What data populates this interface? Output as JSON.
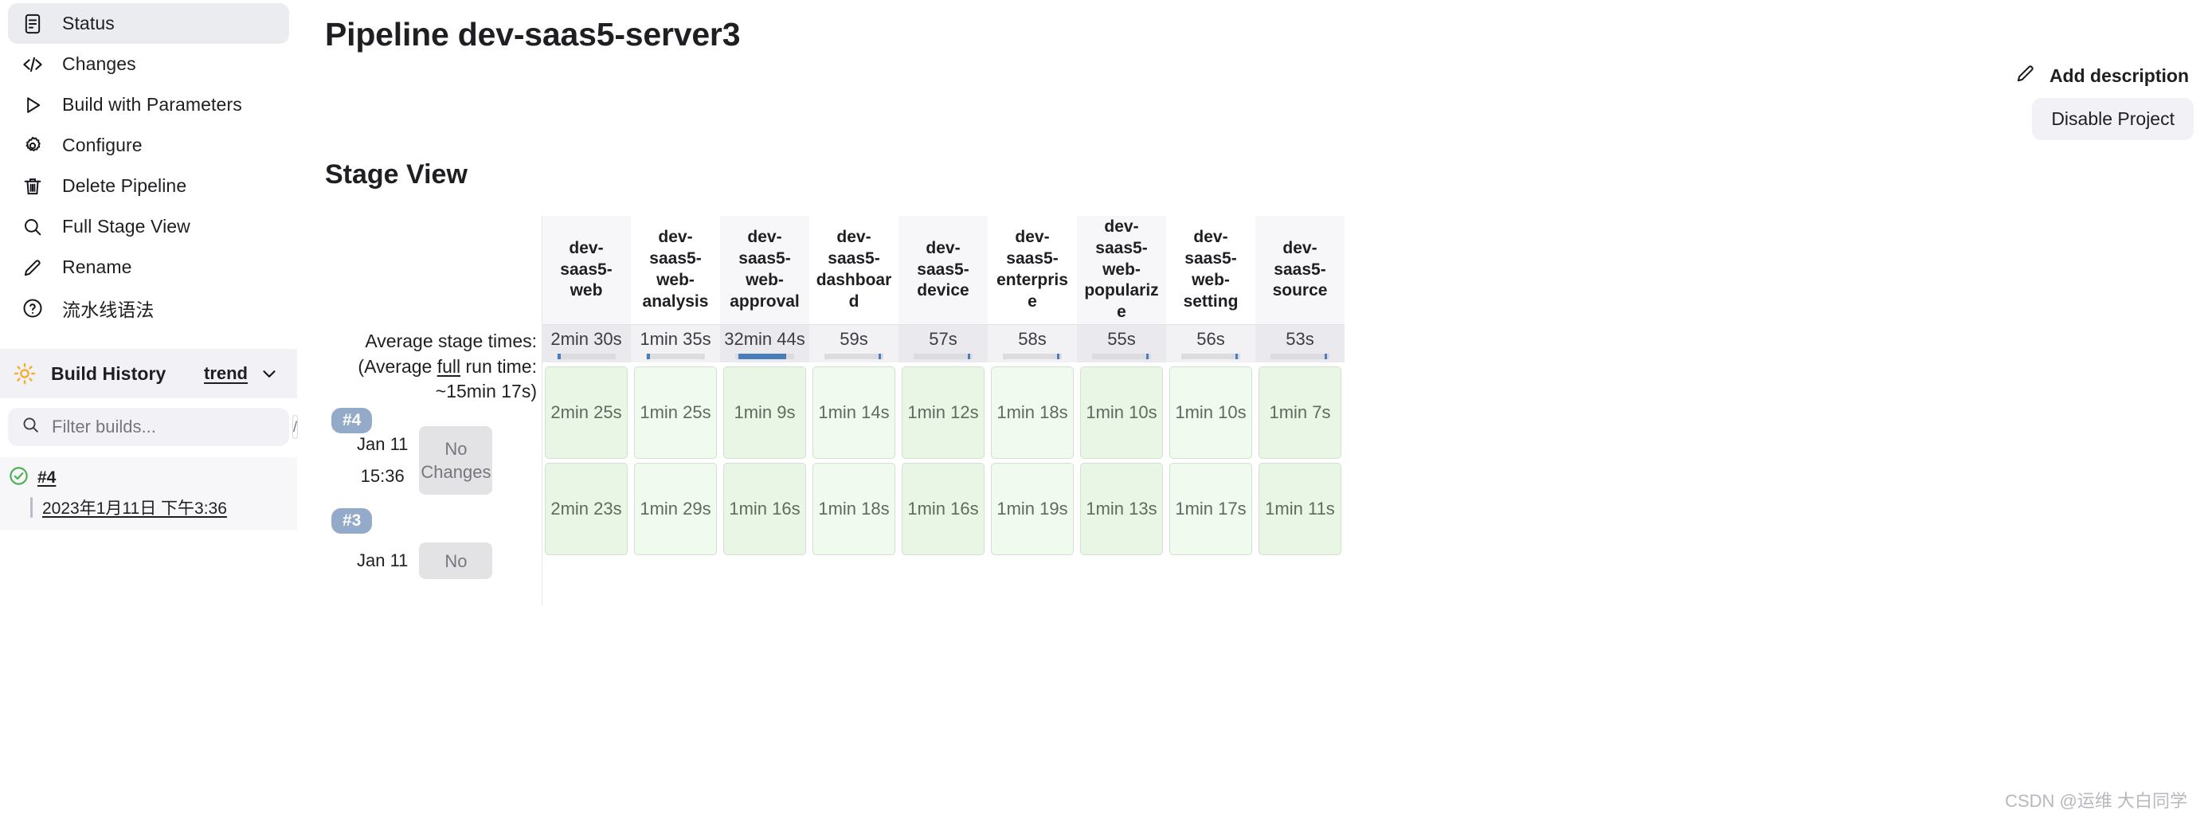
{
  "sidebar": {
    "items": [
      {
        "label": "Status",
        "icon": "document-icon",
        "active": true
      },
      {
        "label": "Changes",
        "icon": "code-icon",
        "active": false
      },
      {
        "label": "Build with Parameters",
        "icon": "play-icon",
        "active": false
      },
      {
        "label": "Configure",
        "icon": "gear-icon",
        "active": false
      },
      {
        "label": "Delete Pipeline",
        "icon": "trash-icon",
        "active": false
      },
      {
        "label": "Full Stage View",
        "icon": "search-icon",
        "active": false
      },
      {
        "label": "Rename",
        "icon": "pencil-icon",
        "active": false
      },
      {
        "label": "流水线语法",
        "icon": "question-icon",
        "active": false
      }
    ],
    "build_history": {
      "title": "Build History",
      "icon": "sun-icon",
      "trend_label": "trend",
      "filter_placeholder": "Filter builds...",
      "filter_value": "",
      "shortcut_key": "/",
      "builds": [
        {
          "number": "#4",
          "date": "2023年1月11日 下午3:36",
          "status": "success"
        }
      ]
    }
  },
  "header": {
    "title": "Pipeline dev-saas5-server3",
    "add_description_label": "Add description",
    "disable_project_label": "Disable Project"
  },
  "stage_view": {
    "title": "Stage View",
    "average_label_line1": "Average stage times:",
    "average_label_line2_pre": "(Average ",
    "average_label_line2_underline": "full",
    "average_label_line2_post": " run time: ~15min 17s)"
  },
  "chart_data": {
    "type": "table",
    "title": "Stage View",
    "categories": [
      "dev-saas5-web",
      "dev-saas5-web-analysis",
      "dev-saas5-web-approval",
      "dev-saas5-dashboard",
      "dev-saas5-device",
      "dev-saas5-enterprise",
      "dev-saas5-web-popularize",
      "dev-saas5-web-setting",
      "dev-saas5-source"
    ],
    "average_times": [
      "2min 30s",
      "1min 35s",
      "32min 44s",
      "59s",
      "57s",
      "58s",
      "55s",
      "56s",
      "53s"
    ],
    "average_seconds": [
      150,
      95,
      1964,
      59,
      57,
      58,
      55,
      56,
      53
    ],
    "progress_percent": [
      8,
      6,
      92,
      4,
      4,
      4,
      4,
      4,
      4
    ],
    "progress_marker_right": [
      false,
      false,
      false,
      true,
      true,
      true,
      true,
      true,
      true
    ],
    "series": [
      {
        "name": "#4",
        "badge": "#4",
        "date": "Jan 11",
        "time": "15:36",
        "changes": "No Changes",
        "values": [
          "2min 25s",
          "1min 25s",
          "1min 9s",
          "1min 14s",
          "1min 12s",
          "1min 18s",
          "1min 10s",
          "1min 10s",
          "1min 7s"
        ],
        "status": "success"
      },
      {
        "name": "#3",
        "badge": "#3",
        "date": "Jan 11",
        "time": "",
        "changes": "No",
        "values": [
          "2min 23s",
          "1min 29s",
          "1min 16s",
          "1min 18s",
          "1min 16s",
          "1min 19s",
          "1min 13s",
          "1min 17s",
          "1min 11s"
        ],
        "status": "success"
      }
    ],
    "xlabel": "",
    "ylabel": "",
    "legend": []
  },
  "watermark": "CSDN @运维 大白同学",
  "colors": {
    "accent_blue": "#4a7ebb",
    "success_green": "#5cb85c",
    "badge_blue": "#93aac9",
    "cell_green": "#e9f6e6",
    "sun_yellow": "#f5ad2e"
  }
}
